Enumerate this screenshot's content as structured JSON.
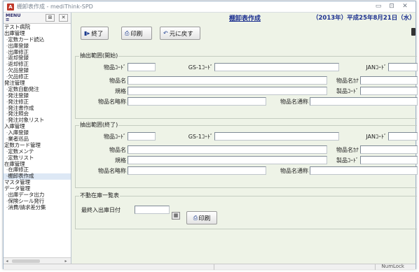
{
  "window": {
    "title": "棚卸表作成 - mediThink-SPD",
    "app_icon_letter": "A",
    "minimize_glyph": "▭",
    "maximize_glyph": "⊡",
    "close_glyph": "✕"
  },
  "sidebar": {
    "menu_label_top": "MENU",
    "menu_label_bottom": "≡",
    "pin_glyph": "⊞",
    "close_glyph": "✕",
    "items": [
      {
        "label": "テスト病院",
        "type": "cat"
      },
      {
        "label": "出庫管理",
        "type": "cat"
      },
      {
        "label": "定数カード読込",
        "type": "item"
      },
      {
        "label": "出庫登録",
        "type": "item"
      },
      {
        "label": "出庫修正",
        "type": "item"
      },
      {
        "label": "返却登録",
        "type": "item"
      },
      {
        "label": "返却修正",
        "type": "item"
      },
      {
        "label": "欠品登録",
        "type": "item"
      },
      {
        "label": "欠品修正",
        "type": "item"
      },
      {
        "label": "発注管理",
        "type": "cat"
      },
      {
        "label": "定数自動発注",
        "type": "item"
      },
      {
        "label": "発注登録",
        "type": "item"
      },
      {
        "label": "発注修正",
        "type": "item"
      },
      {
        "label": "発注書作成",
        "type": "item"
      },
      {
        "label": "発注照会",
        "type": "item"
      },
      {
        "label": "発注対象リスト",
        "type": "item"
      },
      {
        "label": "入庫管理",
        "type": "cat"
      },
      {
        "label": "入庫登録",
        "type": "item"
      },
      {
        "label": "業者巡品",
        "type": "item"
      },
      {
        "label": "定数カード管理",
        "type": "cat"
      },
      {
        "label": "定数メンテ",
        "type": "item"
      },
      {
        "label": "定数リスト",
        "type": "item"
      },
      {
        "label": "在庫管理",
        "type": "cat"
      },
      {
        "label": "在庫修正",
        "type": "item"
      },
      {
        "label": "棚卸表作成",
        "type": "item",
        "selected": true
      },
      {
        "label": "マスタ管理",
        "type": "cat"
      },
      {
        "label": "データ管理",
        "type": "cat"
      },
      {
        "label": "出庫データ出力",
        "type": "item"
      },
      {
        "label": "保険シール発行",
        "type": "item"
      },
      {
        "label": "消費/請求差分集",
        "type": "item"
      }
    ],
    "scroll_left_glyph": "◂",
    "scroll_right_glyph": "▸"
  },
  "header": {
    "title": "棚卸表作成",
    "date": "（2013年）平成25年8月21日（水）"
  },
  "toolbar": {
    "end_label": "終了",
    "print_label": "印刷",
    "back_label": "元に戻す",
    "end_icon": "▮▸",
    "print_icon": "⎙",
    "back_icon": "↶"
  },
  "range_start": {
    "title": "抽出範囲(開始)",
    "item_code_label": "物品ｺｰﾄﾞ",
    "item_code_value": "",
    "gs1_label": "GS-1ｺｰﾄﾞ",
    "gs1_value": "",
    "jan_label": "JANｺｰﾄﾞ",
    "jan_value": "",
    "name_label": "物品名",
    "name_value": "",
    "kana_label": "物品名ｶﾅ",
    "kana_value": "",
    "spec_label": "規格",
    "spec_value": "",
    "product_code_label": "製品ｺｰﾄﾞ",
    "product_code_value": "",
    "abbr_label": "物品名略称",
    "abbr_value": "",
    "common_label": "物品名通称",
    "common_value": ""
  },
  "range_end": {
    "title": "抽出範囲(終了)",
    "item_code_label": "物品ｺｰﾄﾞ",
    "item_code_value": "",
    "gs1_label": "GS-1ｺｰﾄﾞ",
    "gs1_value": "",
    "jan_label": "JANｺｰﾄﾞ",
    "jan_value": "",
    "name_label": "物品名",
    "name_value": "",
    "kana_label": "物品名ｶﾅ",
    "kana_value": "",
    "spec_label": "規格",
    "spec_value": "",
    "product_code_label": "製品ｺｰﾄﾞ",
    "product_code_value": "",
    "abbr_label": "物品名略称",
    "abbr_value": "",
    "common_label": "物品名通称",
    "common_value": ""
  },
  "dead_stock": {
    "title": "不動在庫一覧表",
    "last_date_label": "最終入出庫日付",
    "last_date_value": "",
    "calendar_glyph": "▦",
    "print_label": "印刷",
    "print_icon": "⎙"
  },
  "statusbar": {
    "numlock": "NumLock"
  }
}
